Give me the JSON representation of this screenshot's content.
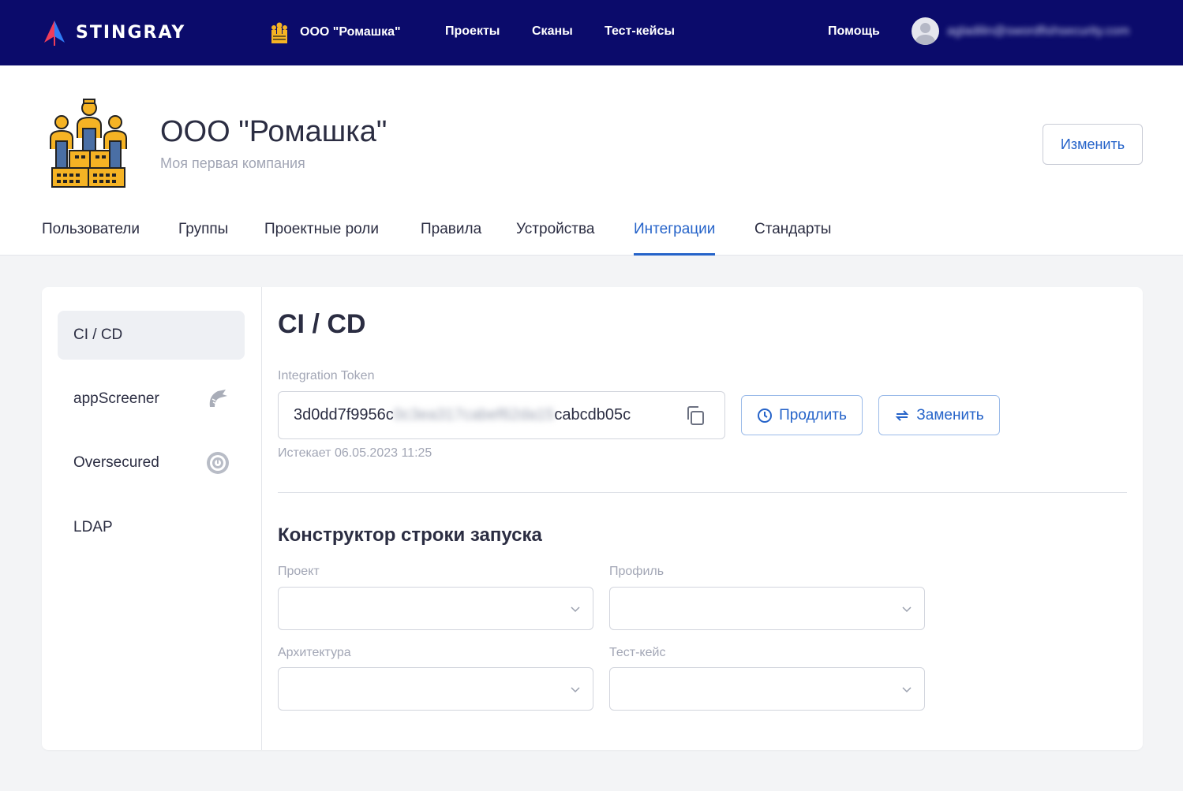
{
  "topbar": {
    "logo_text": "STINGRAY",
    "org_name": "ООО \"Ромашка\"",
    "nav": [
      "Проекты",
      "Сканы",
      "Тест-кейсы"
    ],
    "help": "Помощь",
    "user_email": "agladilin@swordfishsecurity.com"
  },
  "header": {
    "title": "ООО \"Ромашка\"",
    "subtitle": "Моя первая компания",
    "edit_label": "Изменить",
    "tabs": [
      "Пользователи",
      "Группы",
      "Проектные роли",
      "Правила",
      "Устройства",
      "Интеграции",
      "Стандарты"
    ],
    "active_tab": "Интеграции"
  },
  "sidebar": {
    "items": [
      {
        "label": "CI / CD",
        "active": true
      },
      {
        "label": "appScreener",
        "icon": "appscreener-icon"
      },
      {
        "label": "Oversecured",
        "icon": "oversecured-icon"
      },
      {
        "label": "LDAP"
      }
    ]
  },
  "main": {
    "title": "CI / CD",
    "token_label": "Integration Token",
    "token_start": "3d0dd7f9956c",
    "token_hidden": "0c3ea317cabef62da15",
    "token_end": "cabcdb05c",
    "extend_label": "Продлить",
    "replace_label": "Заменить",
    "expires": "Истекает 06.05.2023 11:25",
    "builder_title": "Конструктор строки запуска",
    "fields": {
      "project": "Проект",
      "profile": "Профиль",
      "arch": "Архитектура",
      "testcase": "Тест-кейс"
    }
  },
  "colors": {
    "topbar": "#0b0b6b",
    "accent": "#2563c9"
  }
}
